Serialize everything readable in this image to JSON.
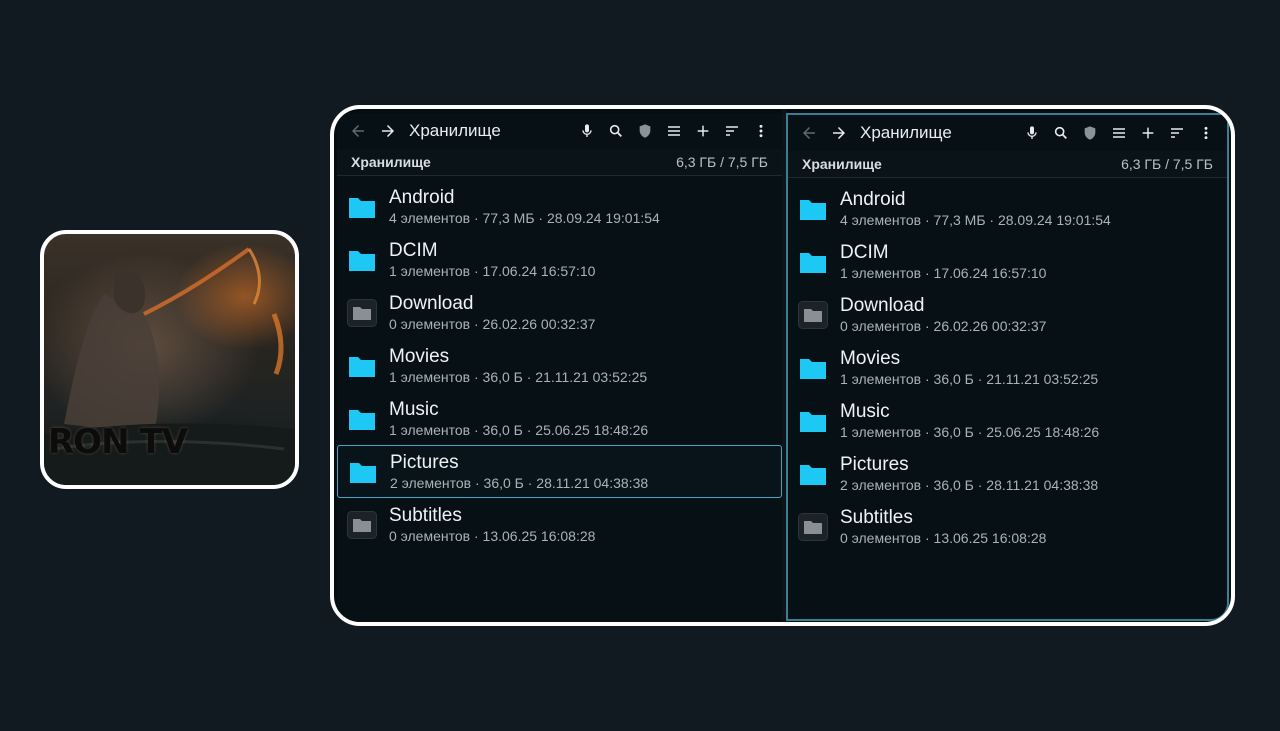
{
  "app_icon": {
    "logo_text": "RON TV"
  },
  "panes": [
    {
      "title": "Хранилище",
      "path_label": "Хранилище",
      "storage": "6,3 ГБ / 7,5 ГБ",
      "items": [
        {
          "name": "Android",
          "details": "4 элементов · 77,3 МБ · 28.09.24 19:01:54",
          "icon": "folder-icon",
          "color": "#1ec8f5"
        },
        {
          "name": "DCIM",
          "details": "1 элементов · 17.06.24 16:57:10",
          "icon": "folder-icon",
          "color": "#1ec8f5"
        },
        {
          "name": "Download",
          "details": "0 элементов · 26.02.26 00:32:37",
          "icon": "folder-icon",
          "color": "#8a8f93"
        },
        {
          "name": "Movies",
          "details": "1 элементов · 36,0 Б · 21.11.21 03:52:25",
          "icon": "folder-icon",
          "color": "#1ec8f5"
        },
        {
          "name": "Music",
          "details": "1 элементов · 36,0 Б · 25.06.25 18:48:26",
          "icon": "folder-icon",
          "color": "#1ec8f5"
        },
        {
          "name": "Pictures",
          "details": "2 элементов · 36,0 Б · 28.11.21 04:38:38",
          "icon": "folder-icon",
          "color": "#1ec8f5"
        },
        {
          "name": "Subtitles",
          "details": "0 элементов · 13.06.25 16:08:28",
          "icon": "folder-icon",
          "color": "#8a8f93"
        }
      ]
    },
    {
      "title": "Хранилище",
      "path_label": "Хранилище",
      "storage": "6,3 ГБ / 7,5 ГБ",
      "items": [
        {
          "name": "Android",
          "details": "4 элементов · 77,3 МБ · 28.09.24 19:01:54",
          "icon": "folder-icon",
          "color": "#1ec8f5"
        },
        {
          "name": "DCIM",
          "details": "1 элементов · 17.06.24 16:57:10",
          "icon": "folder-icon",
          "color": "#1ec8f5"
        },
        {
          "name": "Download",
          "details": "0 элементов · 26.02.26 00:32:37",
          "icon": "folder-icon",
          "color": "#8a8f93"
        },
        {
          "name": "Movies",
          "details": "1 элементов · 36,0 Б · 21.11.21 03:52:25",
          "icon": "folder-icon",
          "color": "#1ec8f5"
        },
        {
          "name": "Music",
          "details": "1 элементов · 36,0 Б · 25.06.25 18:48:26",
          "icon": "folder-icon",
          "color": "#1ec8f5"
        },
        {
          "name": "Pictures",
          "details": "2 элементов · 36,0 Б · 28.11.21 04:38:38",
          "icon": "folder-icon",
          "color": "#1ec8f5"
        },
        {
          "name": "Subtitles",
          "details": "0 элементов · 13.06.25 16:08:28",
          "icon": "folder-icon",
          "color": "#8a8f93"
        }
      ]
    }
  ],
  "toolbar_icons": [
    "back-arrow-icon",
    "forward-arrow-icon",
    "microphone-icon",
    "search-icon",
    "shield-icon",
    "list-view-icon",
    "add-icon",
    "sort-icon",
    "more-vert-icon"
  ],
  "colors": {
    "accent": "#3fa7c6",
    "folder_blue": "#1ec8f5",
    "folder_gray": "#8a8f93",
    "background": "#101a20"
  }
}
